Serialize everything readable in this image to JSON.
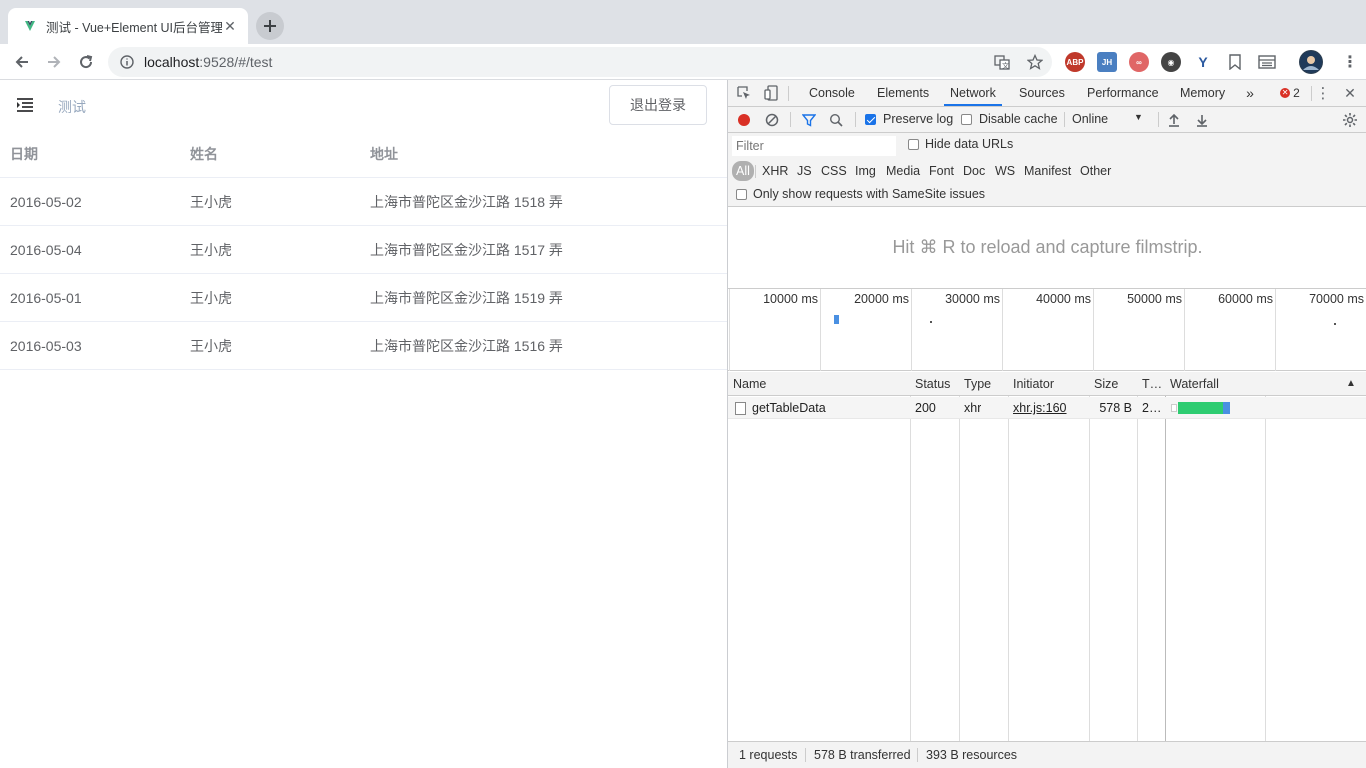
{
  "browser": {
    "tab_title": "测试 - Vue+Element UI后台管理",
    "url_host": "localhost",
    "url_rest": ":9528/#/test"
  },
  "app": {
    "breadcrumb": "测试",
    "logout_label": "退出登录",
    "table": {
      "columns": [
        "日期",
        "姓名",
        "地址"
      ],
      "rows": [
        [
          "2016-05-02",
          "王小虎",
          "上海市普陀区金沙江路 1518 弄"
        ],
        [
          "2016-05-04",
          "王小虎",
          "上海市普陀区金沙江路 1517 弄"
        ],
        [
          "2016-05-01",
          "王小虎",
          "上海市普陀区金沙江路 1519 弄"
        ],
        [
          "2016-05-03",
          "王小虎",
          "上海市普陀区金沙江路 1516 弄"
        ]
      ]
    }
  },
  "devtools": {
    "tabs": [
      "Console",
      "Elements",
      "Network",
      "Sources",
      "Performance",
      "Memory"
    ],
    "active_tab": "Network",
    "error_count": "2",
    "preserve_log_label": "Preserve log",
    "preserve_log_checked": true,
    "disable_cache_label": "Disable cache",
    "throttle_value": "Online",
    "filter_placeholder": "Filter",
    "hide_data_urls_label": "Hide data URLs",
    "type_filters": [
      "All",
      "XHR",
      "JS",
      "CSS",
      "Img",
      "Media",
      "Font",
      "Doc",
      "WS",
      "Manifest",
      "Other"
    ],
    "samesite_label": "Only show requests with SameSite issues",
    "filmstrip_hint": "Hit ⌘ R to reload and capture filmstrip.",
    "overview_ticks": [
      "10000 ms",
      "20000 ms",
      "30000 ms",
      "40000 ms",
      "50000 ms",
      "60000 ms",
      "70000 ms"
    ],
    "columns": [
      "Name",
      "Status",
      "Type",
      "Initiator",
      "Size",
      "T…",
      "Waterfall"
    ],
    "requests": [
      {
        "name": "getTableData",
        "status": "200",
        "type": "xhr",
        "initiator": "xhr.js:160",
        "size": "578 B",
        "time": "2…"
      }
    ],
    "summary": {
      "requests": "1 requests",
      "transferred": "578 B transferred",
      "resources": "393 B resources"
    },
    "colors": {
      "accent": "#1a73e8",
      "record": "#d93025",
      "waterfall_wait": "#2ecc71",
      "waterfall_download": "#4a90e2"
    }
  }
}
